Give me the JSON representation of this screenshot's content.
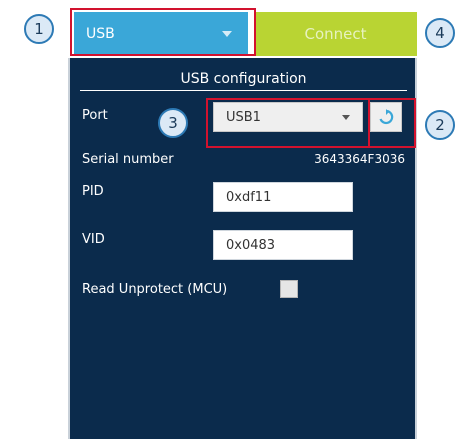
{
  "top_bar": {
    "interface_selected": "USB",
    "connect_label": "Connect"
  },
  "panel": {
    "title": "USB configuration",
    "port_label": "Port",
    "port_value": "USB1",
    "serial_label": "Serial number",
    "serial_value": "3643364F3036",
    "pid_label": "PID",
    "pid_value": "0xdf11",
    "vid_label": "VID",
    "vid_value": "0x0483",
    "read_unprotect_label": "Read Unprotect (MCU)"
  },
  "callouts": [
    "1",
    "2",
    "3",
    "4"
  ],
  "colors": {
    "interface_bg": "#3aa7d8",
    "connect_bg": "#b9d433",
    "panel_bg": "#0b2b4c",
    "highlight": "#d2122e",
    "callout_border": "#2d7ab5"
  },
  "icons": {
    "interface_dropdown": "chevron-down-icon",
    "port_dropdown": "chevron-down-icon",
    "refresh": "refresh-icon"
  }
}
